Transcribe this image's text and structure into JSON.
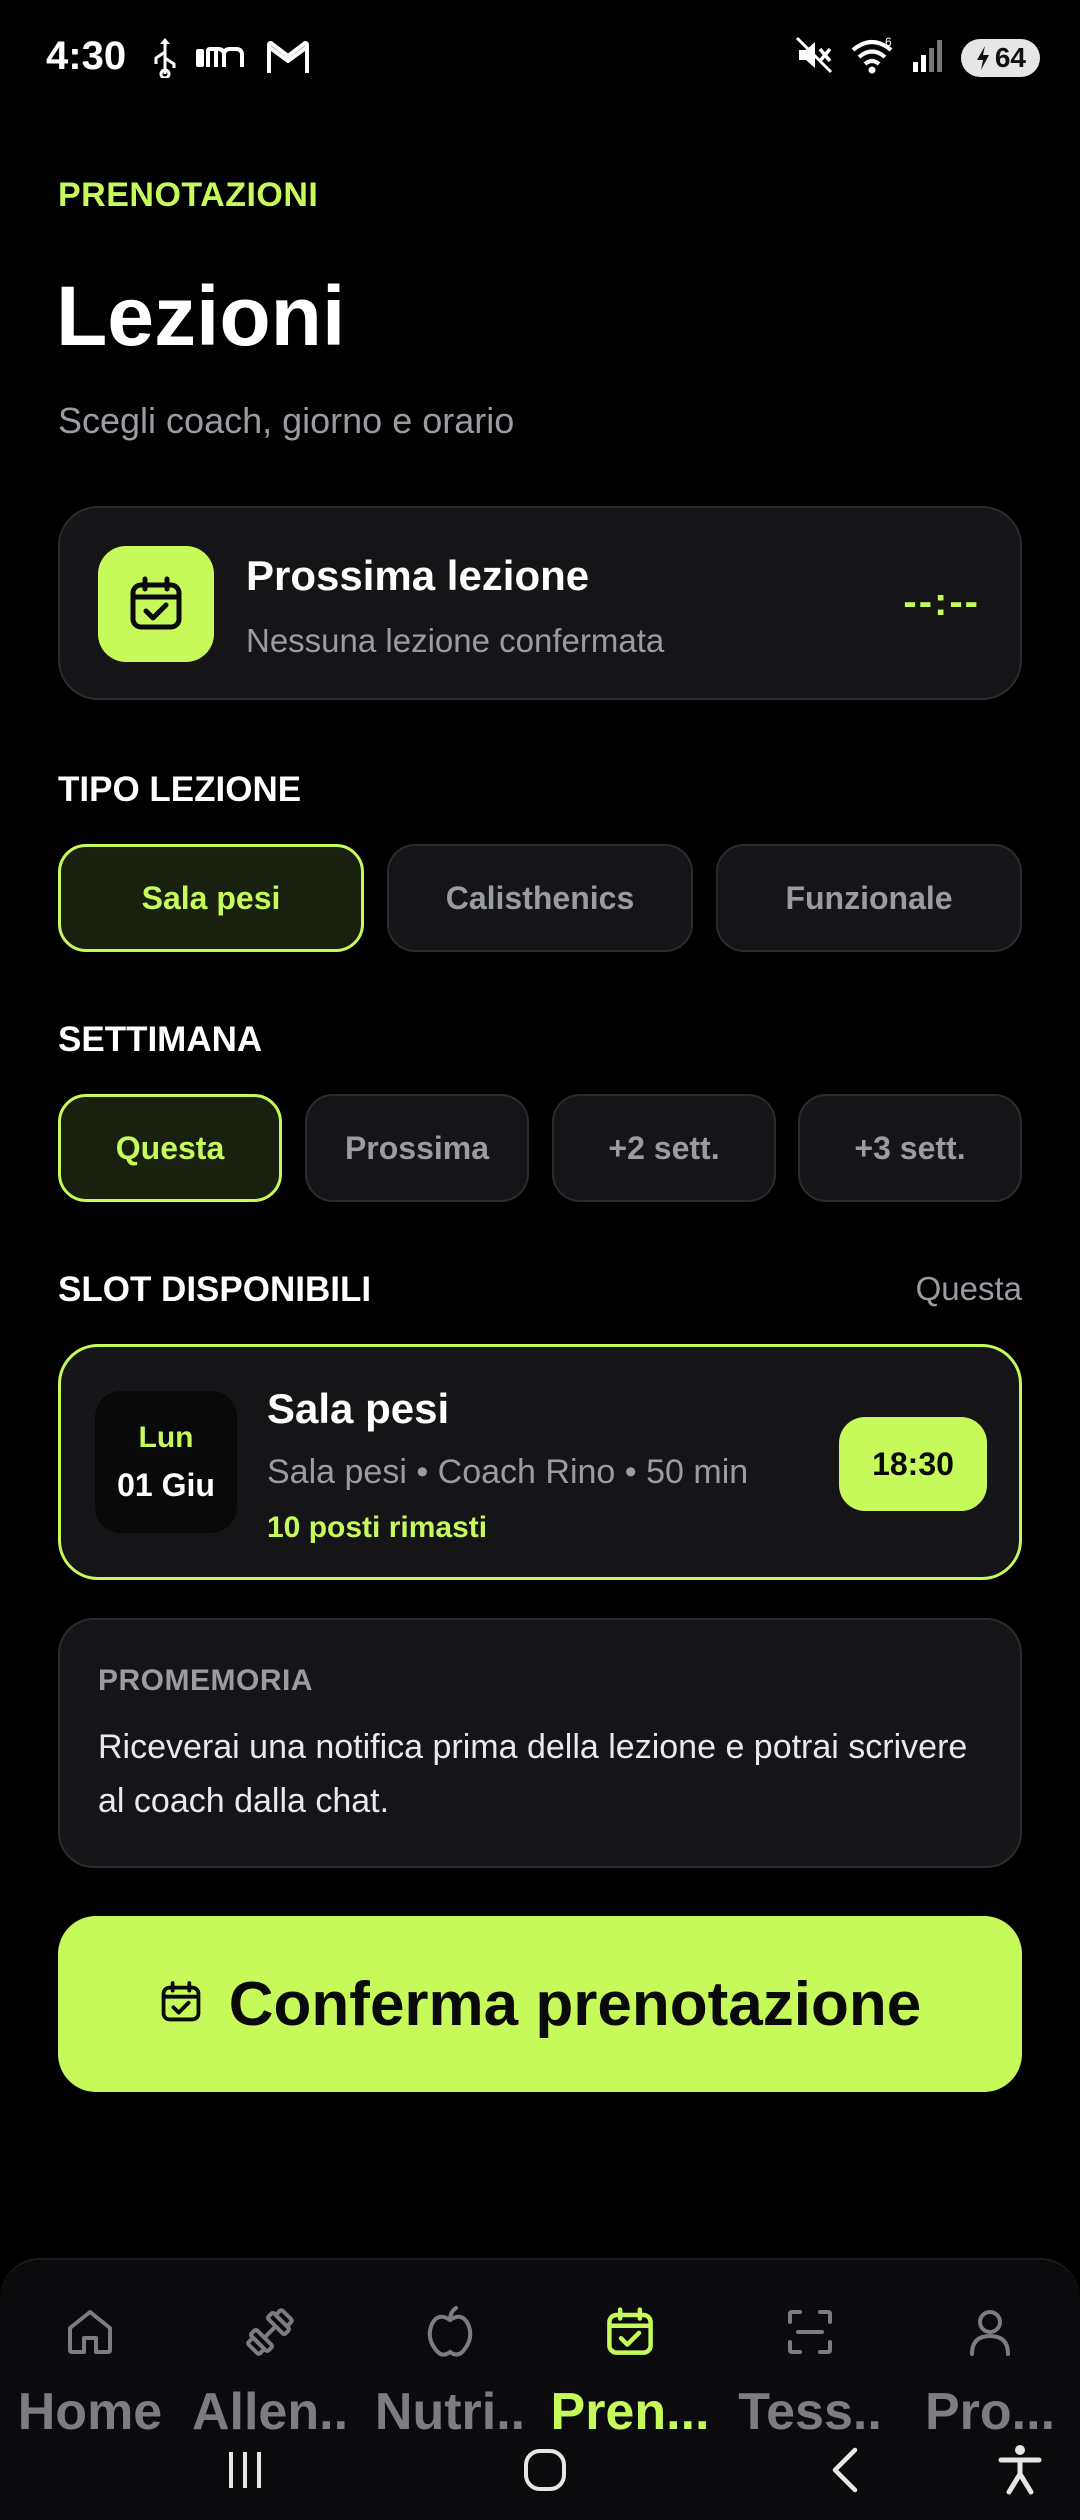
{
  "status_bar": {
    "time": "4:30",
    "battery": "64"
  },
  "header": {
    "kicker": "PRENOTAZIONI",
    "title": "Lezioni",
    "subtitle": "Scegli coach, giorno e orario"
  },
  "next_lesson": {
    "title": "Prossima lezione",
    "subtitle": "Nessuna lezione confermata",
    "time": "--:--"
  },
  "lesson_type": {
    "heading": "TIPO LEZIONE",
    "options": [
      "Sala pesi",
      "Calisthenics",
      "Funzionale"
    ],
    "selected": "Sala pesi"
  },
  "week": {
    "heading": "SETTIMANA",
    "options": [
      "Questa",
      "Prossima",
      "+2 sett.",
      "+3 sett."
    ],
    "selected": "Questa"
  },
  "slots": {
    "heading": "SLOT DISPONIBILI",
    "week_label": "Questa",
    "items": [
      {
        "day": "Lun",
        "date": "01 Giu",
        "title": "Sala pesi",
        "meta": "Sala pesi • Coach Rino • 50 min",
        "seats": "10 posti rimasti",
        "time": "18:30"
      }
    ]
  },
  "reminder": {
    "title": "PROMEMORIA",
    "text": "Riceverai una notifica prima della lezione e potrai scrivere al coach dalla chat."
  },
  "confirm_button": {
    "label": "Conferma prenotazione"
  },
  "bottom_nav": {
    "items": [
      "Home",
      "Allen..",
      "Nutri..",
      "Pren...",
      "Tess..",
      "Pro..."
    ],
    "active": "Pren..."
  },
  "colors": {
    "accent": "#c6f95a",
    "background": "#000000",
    "card": "#151518",
    "muted_text": "#9a9ca3"
  }
}
